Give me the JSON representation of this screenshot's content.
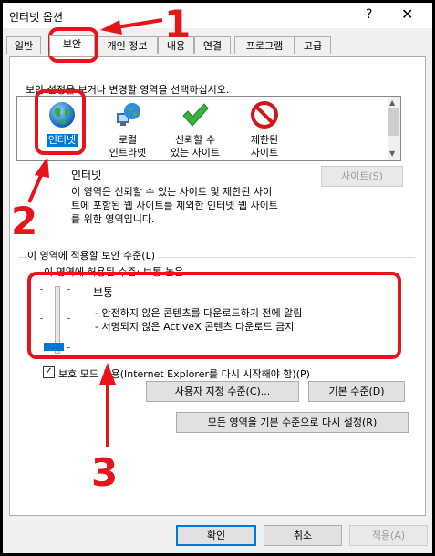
{
  "window": {
    "title": "인터넷 옵션",
    "help": "?",
    "close": "✕"
  },
  "tabs": [
    {
      "label": "일반"
    },
    {
      "label": "보안"
    },
    {
      "label": "개인 정보"
    },
    {
      "label": "내용"
    },
    {
      "label": "연결"
    },
    {
      "label": "프로그램"
    },
    {
      "label": "고급"
    }
  ],
  "security": {
    "instruction": "보안 설정을 보거나 변경할 영역을 선택하십시오.",
    "zones": [
      {
        "label1": "인터넷",
        "label2": "",
        "icon": "globe-icon"
      },
      {
        "label1": "로컬",
        "label2": "인트라넷",
        "icon": "intranet-icon"
      },
      {
        "label1": "신뢰할 수",
        "label2": "있는 사이트",
        "icon": "checkmark-icon"
      },
      {
        "label1": "제한된",
        "label2": "사이트",
        "icon": "restricted-icon"
      }
    ],
    "zone_title": "인터넷",
    "zone_desc": [
      "이 영역은 신뢰할 수 있는 사이트 및 제한된 사이",
      "트에 포함된 웹 사이트를 제외한 인터넷 웹 사이트",
      "를 위한 영역입니다."
    ],
    "sites_button": "사이트(S)",
    "level_group_label": "이 영역에 적용할 보안 수준(L)",
    "allowed_level": "이 영역에 허용된 수준: 보통-높음",
    "level_name": "보통",
    "level_bullets": [
      "- 안전하지 않은 콘텐츠를 다운로드하기 전에 알림",
      "- 서명되지 않은 ActiveX 콘텐츠 다운로드 금지"
    ],
    "slider_level": 0.0,
    "protected_mode_label": "보호 모드 사용(Internet Explorer를 다시 시작해야 함)(P)",
    "protected_mode_checked": true,
    "custom_level_button": "사용자 지정 수준(C)...",
    "default_level_button": "기본 수준(D)",
    "reset_all_button": "모든 영역을 기본 수준으로 다시 설정(R)"
  },
  "footer": {
    "ok": "확인",
    "cancel": "취소",
    "apply": "적용(A)"
  },
  "annotations": {
    "n1": "1",
    "n2": "2",
    "n3": "3"
  },
  "colors": {
    "accent": "#0078d7",
    "annotation": "#e8141c"
  }
}
